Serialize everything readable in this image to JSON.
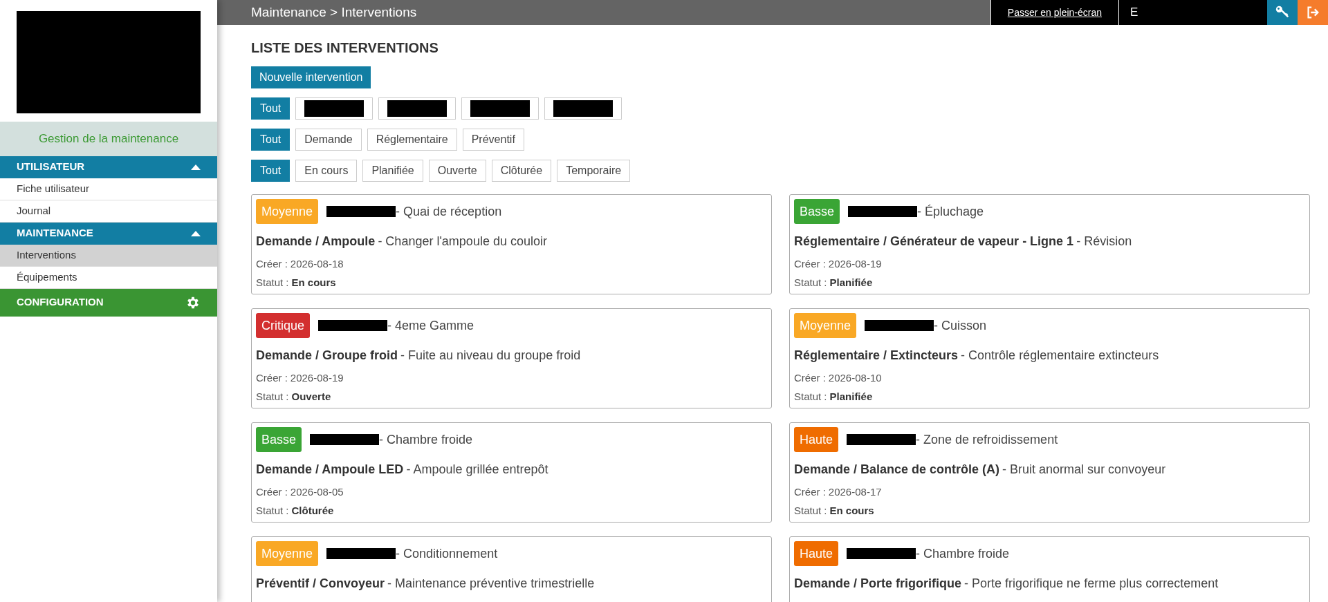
{
  "sidebar": {
    "app_title": "Gestion de la maintenance",
    "sections": [
      {
        "title": "UTILISATEUR",
        "kind": "collapse",
        "expanded": true,
        "items": [
          {
            "label": "Fiche utilisateur",
            "selected": false
          },
          {
            "label": "Journal",
            "selected": false
          }
        ]
      },
      {
        "title": "MAINTENANCE",
        "kind": "collapse",
        "expanded": true,
        "items": [
          {
            "label": "Interventions",
            "selected": true
          },
          {
            "label": "Équipements",
            "selected": false
          }
        ]
      },
      {
        "title": "CONFIGURATION",
        "kind": "settings"
      }
    ]
  },
  "top_bar": {
    "breadcrumb": "Maintenance > Interventions",
    "fullscreen_link": "Passer en plein-écran",
    "user": "E"
  },
  "page": {
    "title": "LISTE DES INTERVENTIONS",
    "new_button": "Nouvelle intervention",
    "filter_groups": [
      [
        {
          "label": "Tout",
          "selected": true
        },
        {
          "kind": "redacted",
          "selected": false
        },
        {
          "kind": "redacted",
          "selected": false
        },
        {
          "kind": "redacted",
          "selected": false
        },
        {
          "kind": "redacted",
          "selected": false
        }
      ],
      [
        {
          "label": "Tout",
          "selected": true
        },
        {
          "label": "Demande",
          "selected": false
        },
        {
          "label": "Réglementaire",
          "selected": false
        },
        {
          "label": "Préventif",
          "selected": false
        }
      ],
      [
        {
          "label": "Tout",
          "selected": true
        },
        {
          "label": "En cours",
          "selected": false
        },
        {
          "label": "Planifiée",
          "selected": false
        },
        {
          "label": "Ouverte",
          "selected": false
        },
        {
          "label": "Clôturée",
          "selected": false
        },
        {
          "label": "Temporaire",
          "selected": false
        }
      ]
    ],
    "interventions": [
      {
        "priority": "Moyenne",
        "color": "#f9a825",
        "location": "- Quai de réception",
        "category": "Demande / Ampoule",
        "description": "- Changer l'ampoule du couloir",
        "created_label": "Créer :",
        "created": "2026-08-18",
        "status_label": "Statut :",
        "status": "En cours"
      },
      {
        "priority": "Basse",
        "color": "#3aa535",
        "location": "- Épluchage",
        "category": "Réglementaire / Générateur de vapeur - Ligne 1",
        "description": "- Révision",
        "created_label": "Créer :",
        "created": "2026-08-19",
        "status_label": "Statut :",
        "status": "Planifiée"
      },
      {
        "priority": "Critique",
        "color": "#d32f2f",
        "location": "- 4eme Gamme",
        "category": "Demande / Groupe froid",
        "description": "- Fuite au niveau du groupe froid",
        "created_label": "Créer :",
        "created": "2026-08-19",
        "status_label": "Statut :",
        "status": "Ouverte"
      },
      {
        "priority": "Moyenne",
        "color": "#f9a825",
        "location": "- Cuisson",
        "category": "Réglementaire / Extincteurs",
        "description": "- Contrôle réglementaire extincteurs",
        "created_label": "Créer :",
        "created": "2026-08-10",
        "status_label": "Statut :",
        "status": "Planifiée"
      },
      {
        "priority": "Basse",
        "color": "#3aa535",
        "location": "- Chambre froide",
        "category": "Demande / Ampoule LED",
        "description": "- Ampoule grillée entrepôt",
        "created_label": "Créer :",
        "created": "2026-08-05",
        "status_label": "Statut :",
        "status": "Clôturée"
      },
      {
        "priority": "Haute",
        "color": "#ef6c00",
        "location": "- Zone de refroidissement",
        "category": "Demande / Balance de contrôle (A)",
        "description": "- Bruit anormal sur convoyeur",
        "created_label": "Créer :",
        "created": "2026-08-17",
        "status_label": "Statut :",
        "status": "En cours"
      },
      {
        "priority": "Moyenne",
        "color": "#f9a825",
        "location": "- Conditionnement",
        "category": "Préventif / Convoyeur",
        "description": "- Maintenance préventive trimestrielle"
      },
      {
        "priority": "Haute",
        "color": "#ef6c00",
        "location": "- Chambre froide",
        "category": "Demande / Porte frigorifique",
        "description": "- Porte frigorifique ne ferme plus correctement"
      }
    ]
  }
}
